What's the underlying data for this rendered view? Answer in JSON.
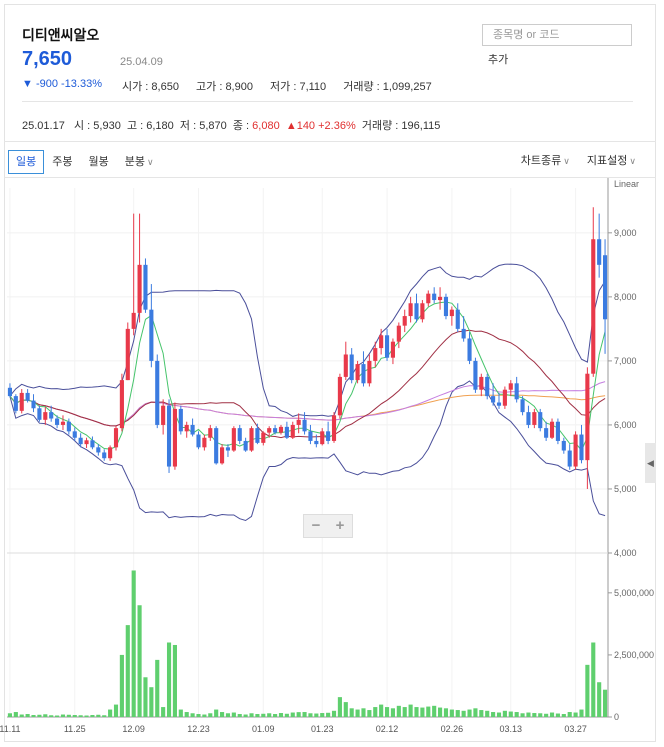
{
  "header": {
    "stock_name": "디티앤씨알오",
    "price": "7,650",
    "date": "25.04.09",
    "change": "▼ -900  -13.33%",
    "stats": [
      {
        "label": "시가",
        "value": "8,650"
      },
      {
        "label": "고가",
        "value": "8,900"
      },
      {
        "label": "저가",
        "value": "7,110"
      },
      {
        "label": "거래량",
        "value": "1,099,257"
      }
    ]
  },
  "search": {
    "placeholder": "종목명 or 코드",
    "add_label": "추가"
  },
  "compare": {
    "date": "25.01.17",
    "open_label": "시",
    "open": "5,930",
    "high_label": "고",
    "high": "6,180",
    "low_label": "저",
    "low": "5,870",
    "close_label": "종",
    "close": "6,080",
    "change": "▲140 +2.36%",
    "volume_label": "거래량",
    "volume": "196,115"
  },
  "tabs": [
    {
      "label": "일봉",
      "active": true
    },
    {
      "label": "주봉",
      "active": false
    },
    {
      "label": "월봉",
      "active": false
    },
    {
      "label": "분봉",
      "active": false
    }
  ],
  "menu": {
    "chart_type": "차트종류",
    "indicator": "지표설정"
  },
  "zoom": {
    "minus": "−",
    "plus": "+"
  },
  "colors": {
    "up": "#e8394a",
    "down": "#3b7be0",
    "volume": "#5fcf6e",
    "bollinger": "#4a4f9a",
    "ma5": "#46c46b",
    "ma20": "#a03045",
    "ma60": "#c57ee0",
    "ma120": "#f0a050"
  },
  "chart_data": {
    "type": "candlestick",
    "scale_label": "Linear",
    "price_ticks": [
      "4,000",
      "5,000",
      "6,000",
      "7,000",
      "8,000",
      "9,000"
    ],
    "price_range": [
      4000,
      9700
    ],
    "volume_ticks": [
      "0",
      "2,500,000",
      "5,000,000"
    ],
    "volume_range": [
      0,
      6000000
    ],
    "x_labels": [
      "11.11",
      "11.25",
      "12.09",
      "12.23",
      "01.09",
      "01.23",
      "02.12",
      "02.26",
      "03.13",
      "03.27"
    ],
    "candles": [
      [
        6580,
        6650,
        6430,
        6450
      ],
      [
        6450,
        6480,
        6180,
        6220
      ],
      [
        6220,
        6560,
        6180,
        6500
      ],
      [
        6500,
        6560,
        6350,
        6380
      ],
      [
        6380,
        6480,
        6200,
        6260
      ],
      [
        6260,
        6300,
        6050,
        6080
      ],
      [
        6080,
        6280,
        6000,
        6200
      ],
      [
        6200,
        6300,
        6050,
        6100
      ],
      [
        6100,
        6150,
        5950,
        6000
      ],
      [
        6000,
        6150,
        5920,
        6050
      ],
      [
        6050,
        6100,
        5850,
        5900
      ],
      [
        5900,
        5960,
        5750,
        5800
      ],
      [
        5800,
        5870,
        5650,
        5700
      ],
      [
        5700,
        5800,
        5640,
        5760
      ],
      [
        5760,
        5820,
        5620,
        5650
      ],
      [
        5650,
        5700,
        5520,
        5570
      ],
      [
        5570,
        5620,
        5440,
        5480
      ],
      [
        5480,
        5680,
        5440,
        5650
      ],
      [
        5650,
        5980,
        5600,
        5950
      ],
      [
        5950,
        6800,
        5900,
        6700
      ],
      [
        6700,
        7600,
        6700,
        7500
      ],
      [
        7500,
        9300,
        7400,
        7750
      ],
      [
        7750,
        9300,
        7600,
        8500
      ],
      [
        8500,
        8600,
        7750,
        7800
      ],
      [
        7800,
        8200,
        6900,
        7000
      ],
      [
        7000,
        7100,
        5950,
        6000
      ],
      [
        6000,
        6400,
        5850,
        6300
      ],
      [
        6300,
        6400,
        5250,
        5350
      ],
      [
        5350,
        6350,
        5300,
        6250
      ],
      [
        6250,
        6300,
        5850,
        5900
      ],
      [
        5900,
        6050,
        5800,
        6000
      ],
      [
        6000,
        6100,
        5820,
        5850
      ],
      [
        5850,
        5900,
        5620,
        5650
      ],
      [
        5650,
        5850,
        5600,
        5800
      ],
      [
        5800,
        6000,
        5750,
        5950
      ],
      [
        5950,
        5980,
        5380,
        5400
      ],
      [
        5400,
        5700,
        5380,
        5650
      ],
      [
        5650,
        5700,
        5500,
        5600
      ],
      [
        5600,
        5980,
        5580,
        5950
      ],
      [
        5950,
        6000,
        5700,
        5750
      ],
      [
        5750,
        5800,
        5580,
        5600
      ],
      [
        5600,
        5980,
        5580,
        5950
      ],
      [
        5950,
        6020,
        5700,
        5720
      ],
      [
        5720,
        5900,
        5680,
        5880
      ],
      [
        5880,
        5980,
        5800,
        5950
      ],
      [
        5950,
        6000,
        5850,
        5880
      ],
      [
        5880,
        6000,
        5850,
        5970
      ],
      [
        5970,
        6050,
        5780,
        5800
      ],
      [
        5800,
        6050,
        5780,
        6000
      ],
      [
        6000,
        6180,
        5870,
        6080
      ],
      [
        6080,
        6200,
        5850,
        5900
      ],
      [
        5900,
        6000,
        5700,
        5750
      ],
      [
        5750,
        5850,
        5650,
        5700
      ],
      [
        5700,
        5950,
        5680,
        5900
      ],
      [
        5900,
        6050,
        5700,
        5750
      ],
      [
        5750,
        6200,
        5720,
        6150
      ],
      [
        6150,
        6800,
        6100,
        6750
      ],
      [
        6750,
        7300,
        6700,
        7100
      ],
      [
        7100,
        7200,
        6650,
        6700
      ],
      [
        6700,
        7000,
        6650,
        6950
      ],
      [
        6950,
        7150,
        6600,
        6650
      ],
      [
        6650,
        7100,
        6600,
        7000
      ],
      [
        7000,
        7300,
        6900,
        7200
      ],
      [
        7200,
        7500,
        7100,
        7400
      ],
      [
        7400,
        7500,
        7000,
        7050
      ],
      [
        7050,
        7350,
        6950,
        7300
      ],
      [
        7300,
        7600,
        7200,
        7550
      ],
      [
        7550,
        7800,
        7450,
        7700
      ],
      [
        7700,
        8000,
        7600,
        7900
      ],
      [
        7900,
        8050,
        7600,
        7650
      ],
      [
        7650,
        7950,
        7600,
        7900
      ],
      [
        7900,
        8100,
        7850,
        8050
      ],
      [
        8050,
        8150,
        7900,
        7950
      ],
      [
        7950,
        8150,
        7800,
        8000
      ],
      [
        8000,
        8050,
        7650,
        7700
      ],
      [
        7700,
        7850,
        7550,
        7800
      ],
      [
        7800,
        7900,
        7450,
        7500
      ],
      [
        7500,
        7700,
        7300,
        7350
      ],
      [
        7350,
        7450,
        6950,
        7000
      ],
      [
        7000,
        7050,
        6500,
        6550
      ],
      [
        6550,
        6800,
        6450,
        6750
      ],
      [
        6750,
        6800,
        6400,
        6450
      ],
      [
        6450,
        6650,
        6300,
        6350
      ],
      [
        6350,
        6500,
        6250,
        6300
      ],
      [
        6300,
        6600,
        6250,
        6550
      ],
      [
        6550,
        6700,
        6450,
        6650
      ],
      [
        6650,
        6750,
        6350,
        6400
      ],
      [
        6400,
        6450,
        6150,
        6200
      ],
      [
        6200,
        6300,
        5950,
        6000
      ],
      [
        6000,
        6250,
        5950,
        6200
      ],
      [
        6200,
        6250,
        5900,
        5950
      ],
      [
        5950,
        6050,
        5750,
        5800
      ],
      [
        5800,
        6100,
        5780,
        6050
      ],
      [
        6050,
        6100,
        5700,
        5750
      ],
      [
        5750,
        5800,
        5550,
        5600
      ],
      [
        5600,
        5700,
        5300,
        5350
      ],
      [
        5350,
        5900,
        5300,
        5850
      ],
      [
        5850,
        6000,
        5400,
        5450
      ],
      [
        5450,
        6900,
        5000,
        6800
      ],
      [
        6800,
        9400,
        6750,
        8900
      ],
      [
        8900,
        9300,
        8300,
        8500
      ],
      [
        8650,
        8900,
        7110,
        7650
      ]
    ],
    "volume": [
      150000,
      200000,
      100000,
      120000,
      80000,
      90000,
      110000,
      70000,
      60000,
      100000,
      90000,
      80000,
      70000,
      60000,
      80000,
      90000,
      70000,
      300000,
      500000,
      2500000,
      3700000,
      5900000,
      4500000,
      1600000,
      1200000,
      2300000,
      400000,
      3000000,
      2900000,
      300000,
      200000,
      150000,
      120000,
      100000,
      150000,
      300000,
      200000,
      150000,
      180000,
      120000,
      100000,
      150000,
      120000,
      130000,
      150000,
      120000,
      160000,
      130000,
      180000,
      196115,
      200000,
      150000,
      140000,
      160000,
      170000,
      250000,
      800000,
      600000,
      350000,
      300000,
      350000,
      280000,
      400000,
      500000,
      400000,
      350000,
      450000,
      400000,
      500000,
      400000,
      380000,
      420000,
      450000,
      380000,
      350000,
      300000,
      280000,
      250000,
      300000,
      350000,
      280000,
      250000,
      200000,
      180000,
      250000,
      220000,
      200000,
      150000,
      180000,
      160000,
      150000,
      130000,
      180000,
      140000,
      120000,
      200000,
      180000,
      300000,
      2100000,
      3000000,
      1400000,
      1099257
    ]
  }
}
